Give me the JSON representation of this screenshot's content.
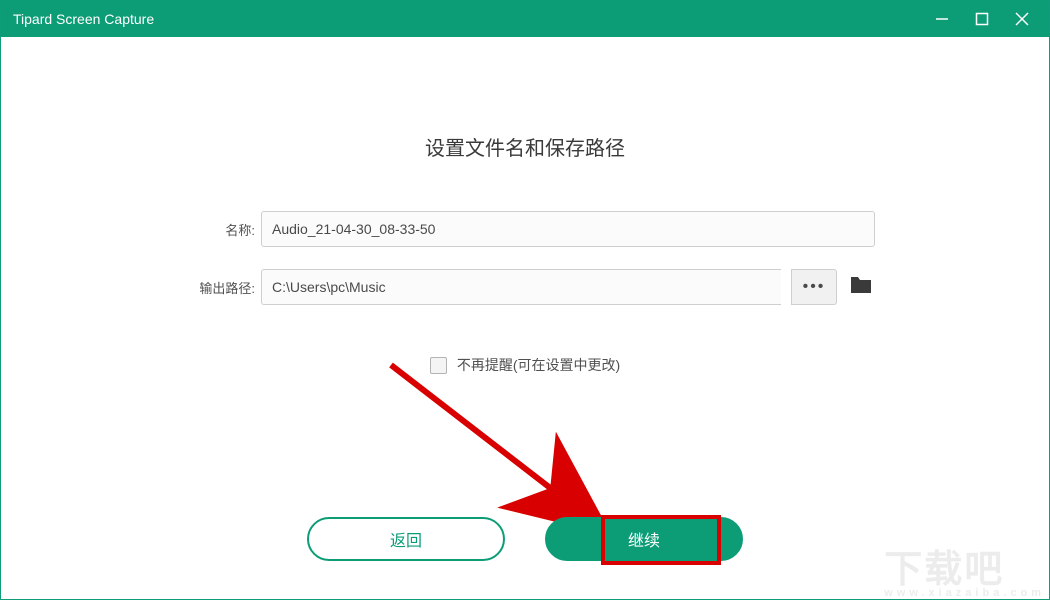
{
  "app": {
    "title": "Tipard Screen Capture"
  },
  "colors": {
    "accent": "#0c9d77",
    "highlight": "#d80000"
  },
  "dialog": {
    "heading": "设置文件名和保存路径",
    "name_label": "名称:",
    "name_value": "Audio_21-04-30_08-33-50",
    "path_label": "输出路径:",
    "path_value": "C:\\Users\\pc\\Music",
    "browse_symbol": "•••",
    "nudge": {
      "checked": false,
      "label": "不再提醒(可在设置中更改)"
    },
    "buttons": {
      "back": "返回",
      "continue": "继续"
    }
  },
  "watermark": {
    "large": "下载吧",
    "small": "www.xiazaiba.com"
  }
}
